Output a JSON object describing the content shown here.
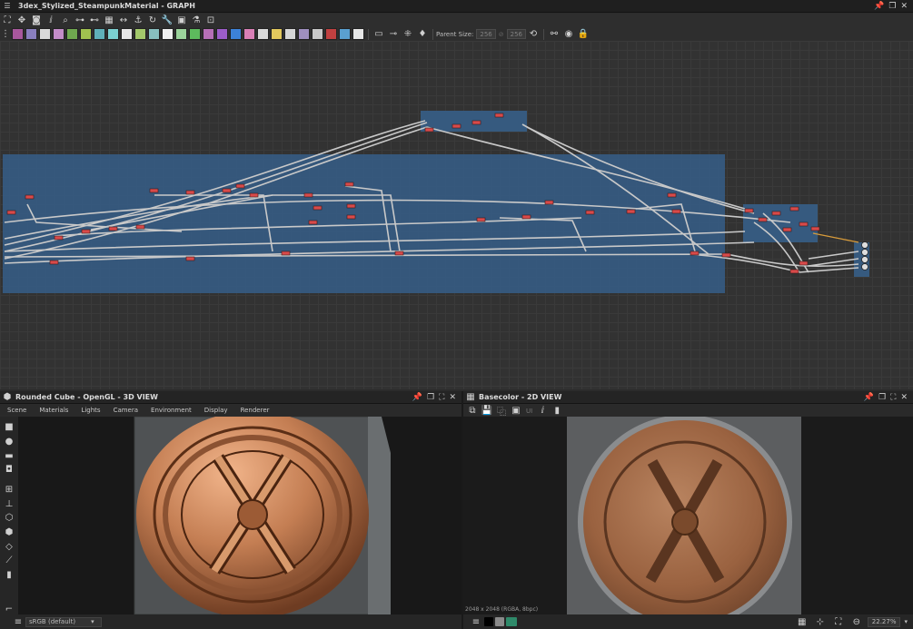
{
  "graph_window": {
    "title": "3dex_Stylized_SteampunkMaterial - GRAPH",
    "toolbar": {
      "parent_size_label": "Parent Size:",
      "parent_size_w": "256",
      "parent_size_h": "256"
    },
    "swatch_colors": [
      "#a8579c",
      "#8a7fbf",
      "#d9d9d9",
      "#c38cc8",
      "#6fa84f",
      "#a0c14f",
      "#5fb0b8",
      "#7bd0d0",
      "#e6e6e6",
      "#a3c96b",
      "#88c0c0",
      "#f0f0f0",
      "#9bd39b",
      "#5dbb5d",
      "#b66fb6",
      "#9c5dc9",
      "#3c82d9",
      "#d97fb6",
      "#d9d9d9",
      "#e2c85d",
      "#d6d6d6",
      "#9f8fbf",
      "#c8c8c8",
      "#c04040",
      "#5aa0d0",
      "#e6e6e6"
    ]
  },
  "view3d": {
    "title": "Rounded Cube - OpenGL - 3D VIEW",
    "menu": [
      "Scene",
      "Materials",
      "Lights",
      "Camera",
      "Environment",
      "Display",
      "Renderer"
    ],
    "colorspace": "sRGB (default)"
  },
  "view2d": {
    "title": "Basecolor - 2D VIEW",
    "tiling_label": "UI",
    "image_info": "2048 x 2048 (RGBA, 8bpc)",
    "zoom": "22.27%"
  },
  "icons": {
    "pin": "pin-icon",
    "restore": "restore-icon",
    "maximize": "maximize-icon",
    "close": "close-icon"
  }
}
